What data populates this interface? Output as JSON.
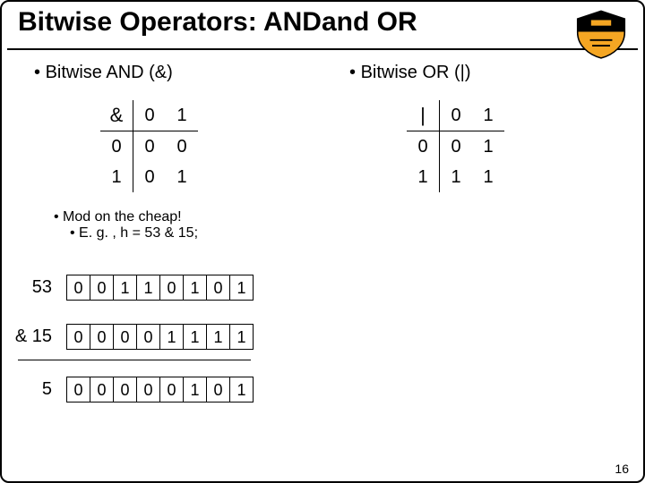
{
  "title": "Bitwise Operators: ANDand OR",
  "page_number": "16",
  "and": {
    "heading": "Bitwise AND (&)",
    "symbol": "&",
    "col_headers": [
      "0",
      "1"
    ],
    "row_labels": [
      "0",
      "1"
    ],
    "rows": [
      [
        "0",
        "0"
      ],
      [
        "0",
        "1"
      ]
    ]
  },
  "or": {
    "heading": "Bitwise OR (|)",
    "symbol": "|",
    "col_headers": [
      "0",
      "1"
    ],
    "row_labels": [
      "0",
      "1"
    ],
    "rows": [
      [
        "0",
        "1"
      ],
      [
        "1",
        "1"
      ]
    ]
  },
  "mod": {
    "line1": "Mod on the cheap!",
    "line2": "E. g. , h = 53 & 15;"
  },
  "example": {
    "row1_label": "53",
    "row1_bits": [
      "0",
      "0",
      "1",
      "1",
      "0",
      "1",
      "0",
      "1"
    ],
    "row2_label": "& 15",
    "row2_bits": [
      "0",
      "0",
      "0",
      "0",
      "1",
      "1",
      "1",
      "1"
    ],
    "row3_label": "5",
    "row3_bits": [
      "0",
      "0",
      "0",
      "0",
      "0",
      "1",
      "0",
      "1"
    ]
  },
  "chart_data": [
    {
      "type": "table",
      "title": "Bitwise AND (&) truth table",
      "categories": [
        "0",
        "1"
      ],
      "row_labels": [
        "0",
        "1"
      ],
      "values": [
        [
          0,
          0
        ],
        [
          0,
          1
        ]
      ]
    },
    {
      "type": "table",
      "title": "Bitwise OR (|) truth table",
      "categories": [
        "0",
        "1"
      ],
      "row_labels": [
        "0",
        "1"
      ],
      "values": [
        [
          0,
          1
        ],
        [
          1,
          1
        ]
      ]
    },
    {
      "type": "table",
      "title": "53 & 15 = 5 (binary)",
      "row_labels": [
        "53",
        "& 15",
        "5"
      ],
      "values": [
        [
          0,
          0,
          1,
          1,
          0,
          1,
          0,
          1
        ],
        [
          0,
          0,
          0,
          0,
          1,
          1,
          1,
          1
        ],
        [
          0,
          0,
          0,
          0,
          0,
          1,
          0,
          1
        ]
      ]
    }
  ]
}
